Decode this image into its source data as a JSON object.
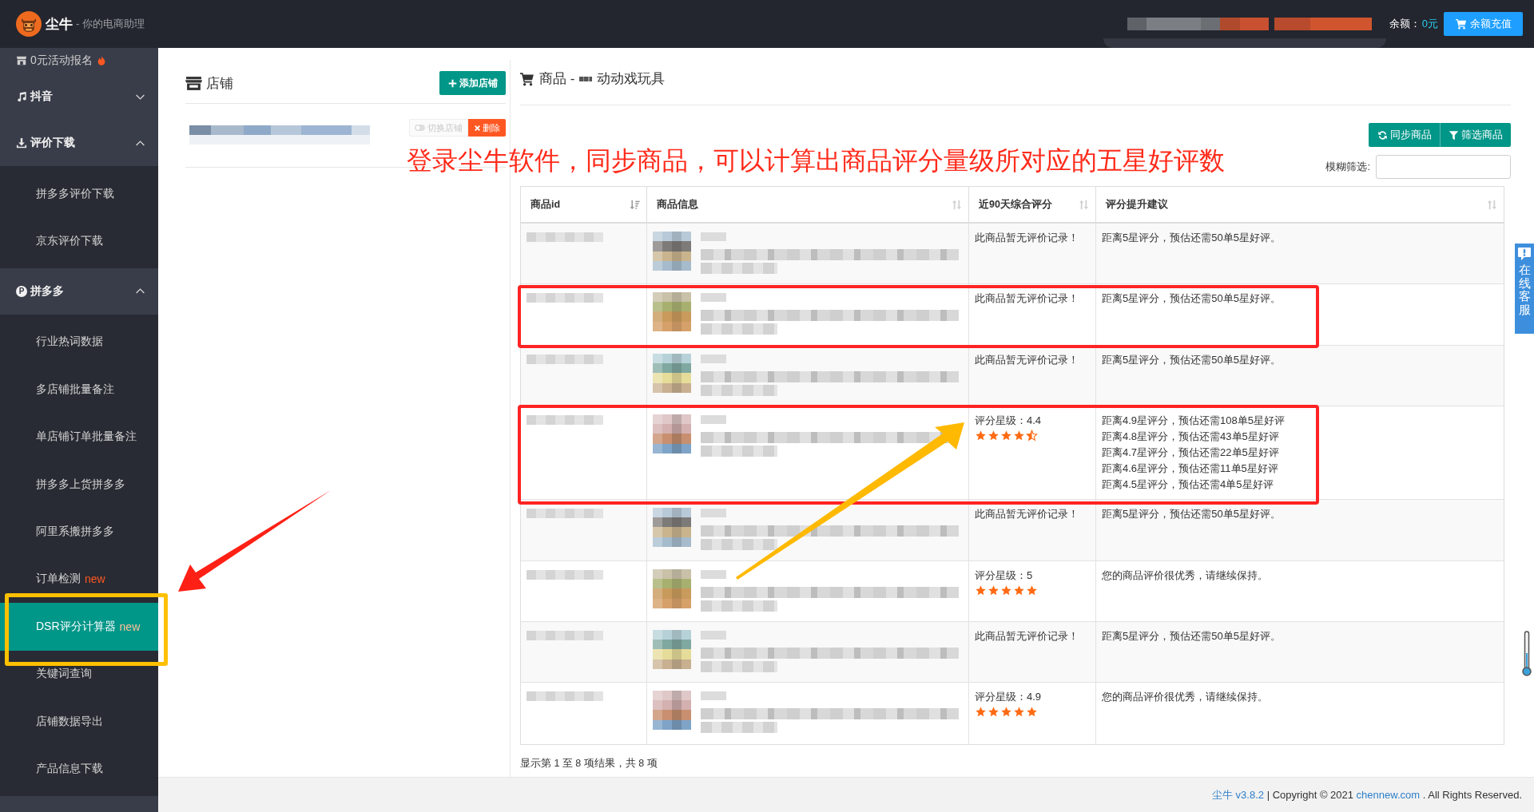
{
  "header": {
    "brand": "尘牛",
    "tagline": "- 你的电商助理",
    "balance_label": "余额：",
    "balance_value": "0元",
    "recharge_button": "余额充值"
  },
  "sidebar": {
    "items": [
      {
        "kind": "link",
        "label": "0元活动报名",
        "hot": true
      },
      {
        "kind": "group",
        "label": "抖音",
        "expanded": false
      },
      {
        "kind": "group",
        "label": "评价下载",
        "expanded": true,
        "children": [
          {
            "label": "拼多多评价下载",
            "selected": false,
            "highlighted": false
          },
          {
            "label": "京东评价下载",
            "selected": false,
            "highlighted": false
          }
        ]
      },
      {
        "kind": "group",
        "label": "拼多多",
        "icon_letter": "P",
        "expanded": true,
        "children": [
          {
            "label": "行业热词数据",
            "selected": false,
            "highlighted": false
          },
          {
            "label": "多店铺批量备注",
            "selected": false,
            "highlighted": false
          },
          {
            "label": "单店铺订单批量备注",
            "selected": false,
            "highlighted": false
          },
          {
            "label": "拼多多上货拼多多",
            "selected": false,
            "highlighted": false
          },
          {
            "label": "阿里系搬拼多多",
            "selected": false,
            "highlighted": false
          },
          {
            "label": "订单检测",
            "badge": "new",
            "selected": false,
            "highlighted": false
          },
          {
            "label": "DSR评分计算器",
            "badge": "new",
            "selected": true,
            "highlighted": true
          },
          {
            "label": "关键词查询",
            "selected": false,
            "highlighted": false
          },
          {
            "label": "店铺数据导出",
            "selected": false,
            "highlighted": false
          },
          {
            "label": "产品信息下载",
            "selected": false,
            "highlighted": false
          }
        ]
      }
    ]
  },
  "stores": {
    "title": "店铺",
    "add_button": "添加店铺",
    "items": [
      {
        "current": true,
        "switch_button": "切换店铺",
        "delete_button": "删除"
      }
    ]
  },
  "products": {
    "title": "商品 -",
    "shop_name": "动动戏玩具",
    "sync_button": "同步商品",
    "filter_button": "筛选商品",
    "search_label": "模糊筛选:",
    "table": {
      "columns": [
        {
          "label": "商品id",
          "sorted": true
        },
        {
          "label": "商品信息",
          "sorted": false
        },
        {
          "label": "近90天综合评分",
          "sorted": false
        },
        {
          "label": "评分提升建议",
          "sorted": false
        }
      ],
      "rows": [
        {
          "kind": "none",
          "score": "此商品暂无评价记录！",
          "advice": [
            "距离5星评分，预估还需50单5星好评。"
          ],
          "highlighted": false
        },
        {
          "kind": "none",
          "score": "此商品暂无评价记录！",
          "advice": [
            "距离5星评分，预估还需50单5星好评。"
          ],
          "highlighted": true
        },
        {
          "kind": "none",
          "score": "此商品暂无评价记录！",
          "advice": [
            "距离5星评分，预估还需50单5星好评。"
          ],
          "highlighted": false
        },
        {
          "kind": "rated",
          "score": "评分星级：4.4",
          "stars": 4.5,
          "advice": [
            "距离4.9星评分，预估还需108单5星好评",
            "距离4.8星评分，预估还需43单5星好评",
            "距离4.7星评分，预估还需22单5星好评",
            "距离4.6星评分，预估还需11单5星好评",
            "距离4.5星评分，预估还需4单5星好评"
          ],
          "highlighted": true
        },
        {
          "kind": "none",
          "score": "此商品暂无评价记录！",
          "advice": [
            "距离5星评分，预估还需50单5星好评。"
          ],
          "highlighted": false
        },
        {
          "kind": "rated",
          "score": "评分星级：5",
          "stars": 5,
          "advice": [
            "您的商品评价很优秀，请继续保持。"
          ],
          "highlighted": false
        },
        {
          "kind": "none",
          "score": "此商品暂无评价记录！",
          "advice": [
            "距离5星评分，预估还需50单5星好评。"
          ],
          "highlighted": false
        },
        {
          "kind": "rated",
          "score": "评分星级：4.9",
          "stars": 5,
          "advice": [
            "您的商品评价很优秀，请继续保持。"
          ],
          "highlighted": false
        }
      ]
    },
    "summary": "显示第 1 至 8 项结果，共 8 项"
  },
  "annotation": {
    "caption": "登录尘牛软件，同步商品，可以计算出商品评分量级所对应的五星好评数"
  },
  "support_tab": "在线客服",
  "footer": {
    "version": "尘牛 v3.8.2",
    "copyright": "| Copyright © 2021",
    "site": "chennew.com",
    "rights": ". All Rights Reserved."
  }
}
